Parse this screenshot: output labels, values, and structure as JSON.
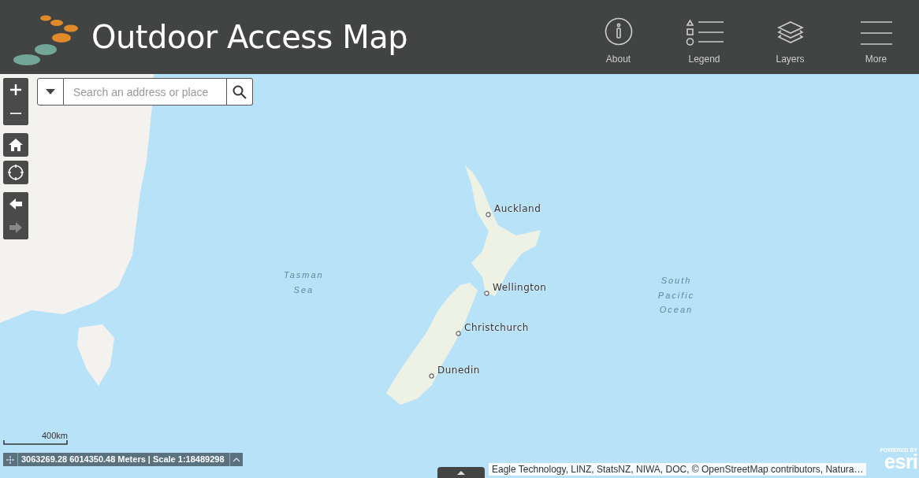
{
  "header": {
    "title": "Outdoor Access Map",
    "nav_items": [
      {
        "kind": "about",
        "label": "About"
      },
      {
        "kind": "legend",
        "label": "Legend"
      },
      {
        "kind": "layers",
        "label": "Layers"
      },
      {
        "kind": "more",
        "label": "More"
      }
    ]
  },
  "search": {
    "placeholder": "Search an address or place"
  },
  "navigation": [
    {
      "kind": "back",
      "disabled": false
    },
    {
      "kind": "forward",
      "disabled": true
    }
  ],
  "map": {
    "labels": [
      {
        "kind": "city",
        "text": "Auckland"
      },
      {
        "kind": "city",
        "text": "Wellington"
      },
      {
        "kind": "city",
        "text": "Christchurch"
      },
      {
        "kind": "city",
        "text": "Dunedin"
      },
      {
        "kind": "sea",
        "text": "Tasman Sea"
      },
      {
        "kind": "sea",
        "text": "South Pacific Ocean"
      }
    ]
  },
  "scale_bar": {
    "label": "400km"
  },
  "coordinates": {
    "text": "3063269.28 6014350.48 Meters | Scale 1:18489298"
  },
  "attribution": "Eagle Technology, LINZ, StatsNZ, NIWA, DOC, © OpenStreetMap contributors, Natura…",
  "esri_badge": {
    "caption": "POWERED BY",
    "logo": "esri"
  }
}
